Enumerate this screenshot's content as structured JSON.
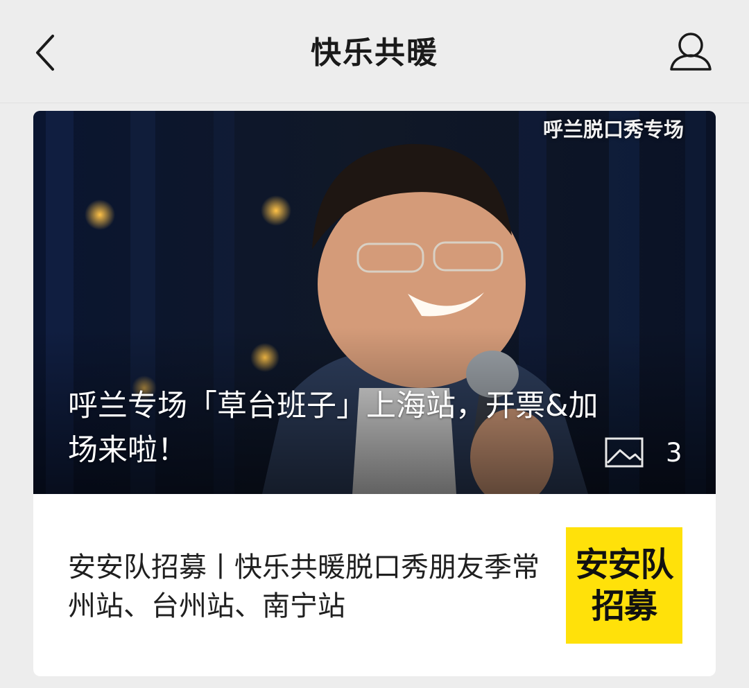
{
  "header": {
    "title": "快乐共暖",
    "back_icon": "chevron-left-icon",
    "profile_icon": "person-icon"
  },
  "articles": [
    {
      "cover_tag": "呼兰脱口秀专场",
      "title": "呼兰专场「草台班子」上海站，开票&加场来啦！",
      "image_icon": "image-icon",
      "image_count": "3"
    },
    {
      "title": "安安队招募丨快乐共暖脱口秀朋友季常州站、台州站、南宁站",
      "thumbnail_lines": [
        "安安队",
        "招募"
      ],
      "thumbnail_color": "#ffe10a"
    }
  ]
}
